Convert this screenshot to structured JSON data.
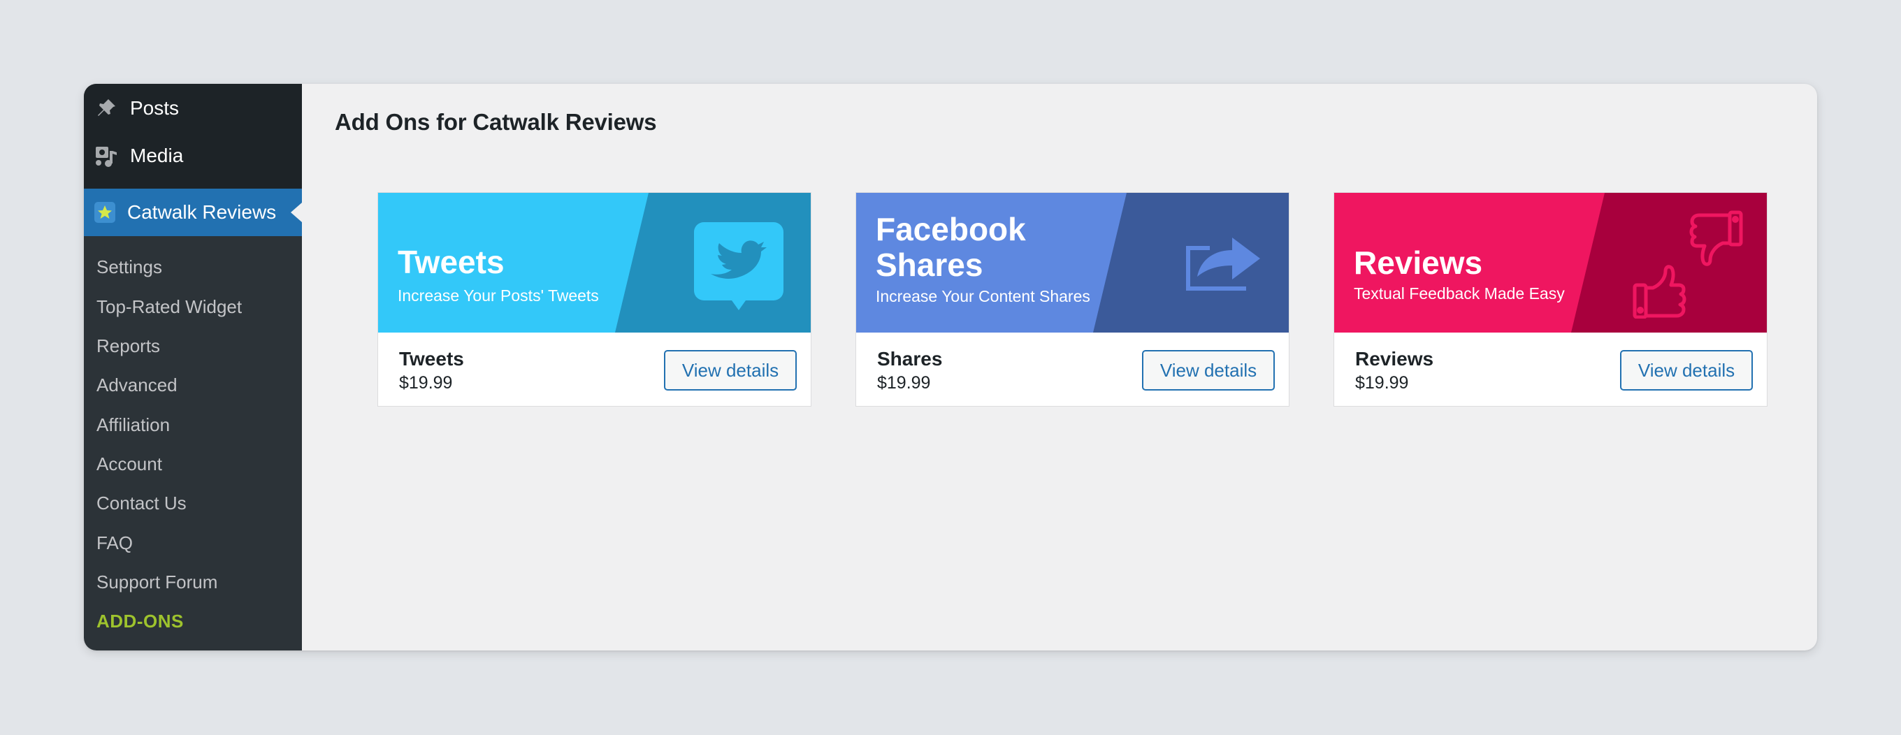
{
  "sidebar": {
    "menu": [
      {
        "label": "Posts",
        "icon": "pushpin-icon"
      },
      {
        "label": "Media",
        "icon": "media-icon"
      }
    ],
    "active": {
      "label": "Catwalk Reviews",
      "icon": "catwalk-star-icon"
    },
    "submenu": [
      "Settings",
      "Top-Rated Widget",
      "Reports",
      "Advanced",
      "Affiliation",
      "Account",
      "Contact Us",
      "FAQ",
      "Support Forum",
      "ADD-ONS"
    ],
    "current_submenu": "ADD-ONS"
  },
  "page": {
    "title": "Add Ons for Catwalk Reviews"
  },
  "addons": [
    {
      "banner_title": "Tweets",
      "banner_subtitle": "Increase Your Posts' Tweets",
      "name": "Tweets",
      "price": "$19.99",
      "button": "View details",
      "icon": "twitter-bird-icon",
      "colors": {
        "main": "#33c8f9",
        "diag": "#2290bd"
      }
    },
    {
      "banner_title_line1": "Facebook",
      "banner_title_line2": "Shares",
      "banner_subtitle": "Increase Your Content Shares",
      "name": "Shares",
      "price": "$19.99",
      "button": "View details",
      "icon": "share-arrow-icon",
      "colors": {
        "main": "#5e88e0",
        "diag": "#3b5a9a"
      }
    },
    {
      "banner_title": "Reviews",
      "banner_subtitle": "Textual Feedback Made Easy",
      "name": "Reviews",
      "price": "$19.99",
      "button": "View details",
      "icon": "thumbs-up-down-icon",
      "colors": {
        "main": "#ef1660",
        "diag": "#a8003d"
      }
    }
  ],
  "colors": {
    "admin_bar": "#1d2327",
    "sidebar": "#2c3338",
    "accent": "#2271b1",
    "addons_highlight": "#9ec32d"
  }
}
